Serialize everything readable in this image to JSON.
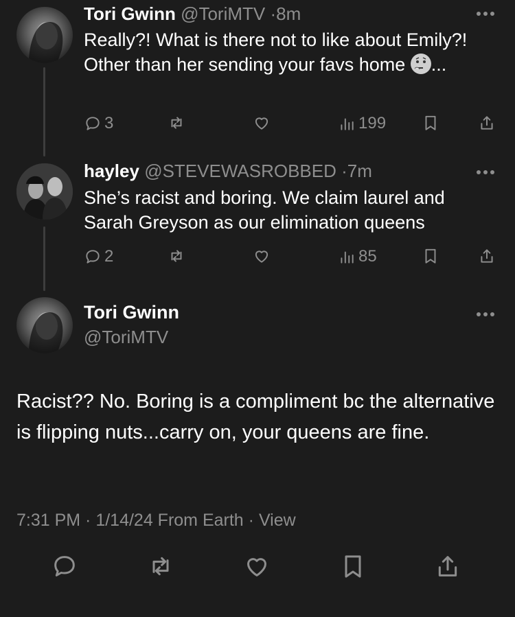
{
  "tweets": [
    {
      "name": "Tori Gwinn",
      "handle": "@ToriMTV",
      "separator": "·",
      "time": "8m",
      "text_before_emoji": "Really?! What is there not to like about Emily?! Other than her sending your favs home ",
      "text_after_emoji": "...",
      "emoji_icon": "thinking-face-icon",
      "replies": "3",
      "views": "199"
    },
    {
      "name": "hayley",
      "handle": "@STEVEWASROBBED",
      "separator": "·",
      "time": "7m",
      "text": "She’s racist and boring. We claim laurel and Sarah Greyson as our elimination queens",
      "replies": "2",
      "views": "85"
    }
  ],
  "main_tweet": {
    "name": "Tori Gwinn",
    "handle": "@ToriMTV",
    "text": "Racist?? No. Boring is a compliment bc the alternative is flipping nuts...carry on, your queens are fine.",
    "timestamp": "7:31 PM · 1/14/24 From Earth",
    "separator": "·",
    "view_link": "View"
  },
  "icons": [
    "reply-icon",
    "retweet-icon",
    "like-icon",
    "views-icon",
    "bookmark-icon",
    "share-icon",
    "more-icon"
  ],
  "colors": {
    "background": "#1c1c1c",
    "text": "#ffffff",
    "muted": "#8e8e8e",
    "thread_line": "#3d3d3d"
  }
}
